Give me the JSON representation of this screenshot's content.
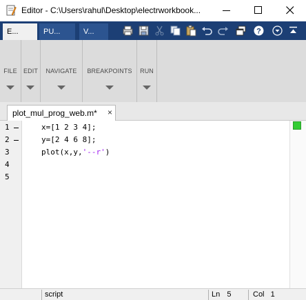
{
  "window": {
    "title": "Editor - C:\\Users\\rahul\\Desktop\\electrworkbook...",
    "icon": "matlab-editor-icon"
  },
  "toolstrip_tabs": [
    {
      "label": "E...",
      "active": true
    },
    {
      "label": "PU...",
      "active": false
    },
    {
      "label": "V...",
      "active": false
    }
  ],
  "quick_access": [
    "print-icon",
    "save-icon",
    "cut-icon",
    "copy-icon",
    "paste-icon",
    "undo-icon",
    "redo-icon",
    "switch-windows-icon",
    "help-icon",
    "expand-options-icon",
    "minimize-toolstrip-icon"
  ],
  "ribbon": {
    "sections": [
      {
        "label": "FILE"
      },
      {
        "label": "EDIT"
      },
      {
        "label": "NAVIGATE"
      },
      {
        "label": "BREAKPOINTS"
      },
      {
        "label": "RUN"
      }
    ]
  },
  "document_tab": {
    "label": "plot_mul_prog_web.m*",
    "close": "×"
  },
  "code_lines": [
    {
      "number": "1",
      "breakpoint_marker": true,
      "text": "x=[1 2 3 4];"
    },
    {
      "number": "2",
      "breakpoint_marker": true,
      "text": "y=[2 4 6 8];"
    },
    {
      "number": "3",
      "breakpoint_marker": false,
      "pre": "plot(x,y,",
      "str": "'--r'",
      "post": ")"
    },
    {
      "number": "4",
      "breakpoint_marker": false,
      "text": ""
    },
    {
      "number": "5",
      "breakpoint_marker": false,
      "text": ""
    }
  ],
  "status": {
    "file_type": "script",
    "ln_label": "Ln",
    "ln_value": "5",
    "col_label": "Col",
    "col_value": "1"
  },
  "colors": {
    "toolstrip_bar": "#1c3f75",
    "string_literal": "#a020f0",
    "analyzer_ok": "#33cc33"
  }
}
